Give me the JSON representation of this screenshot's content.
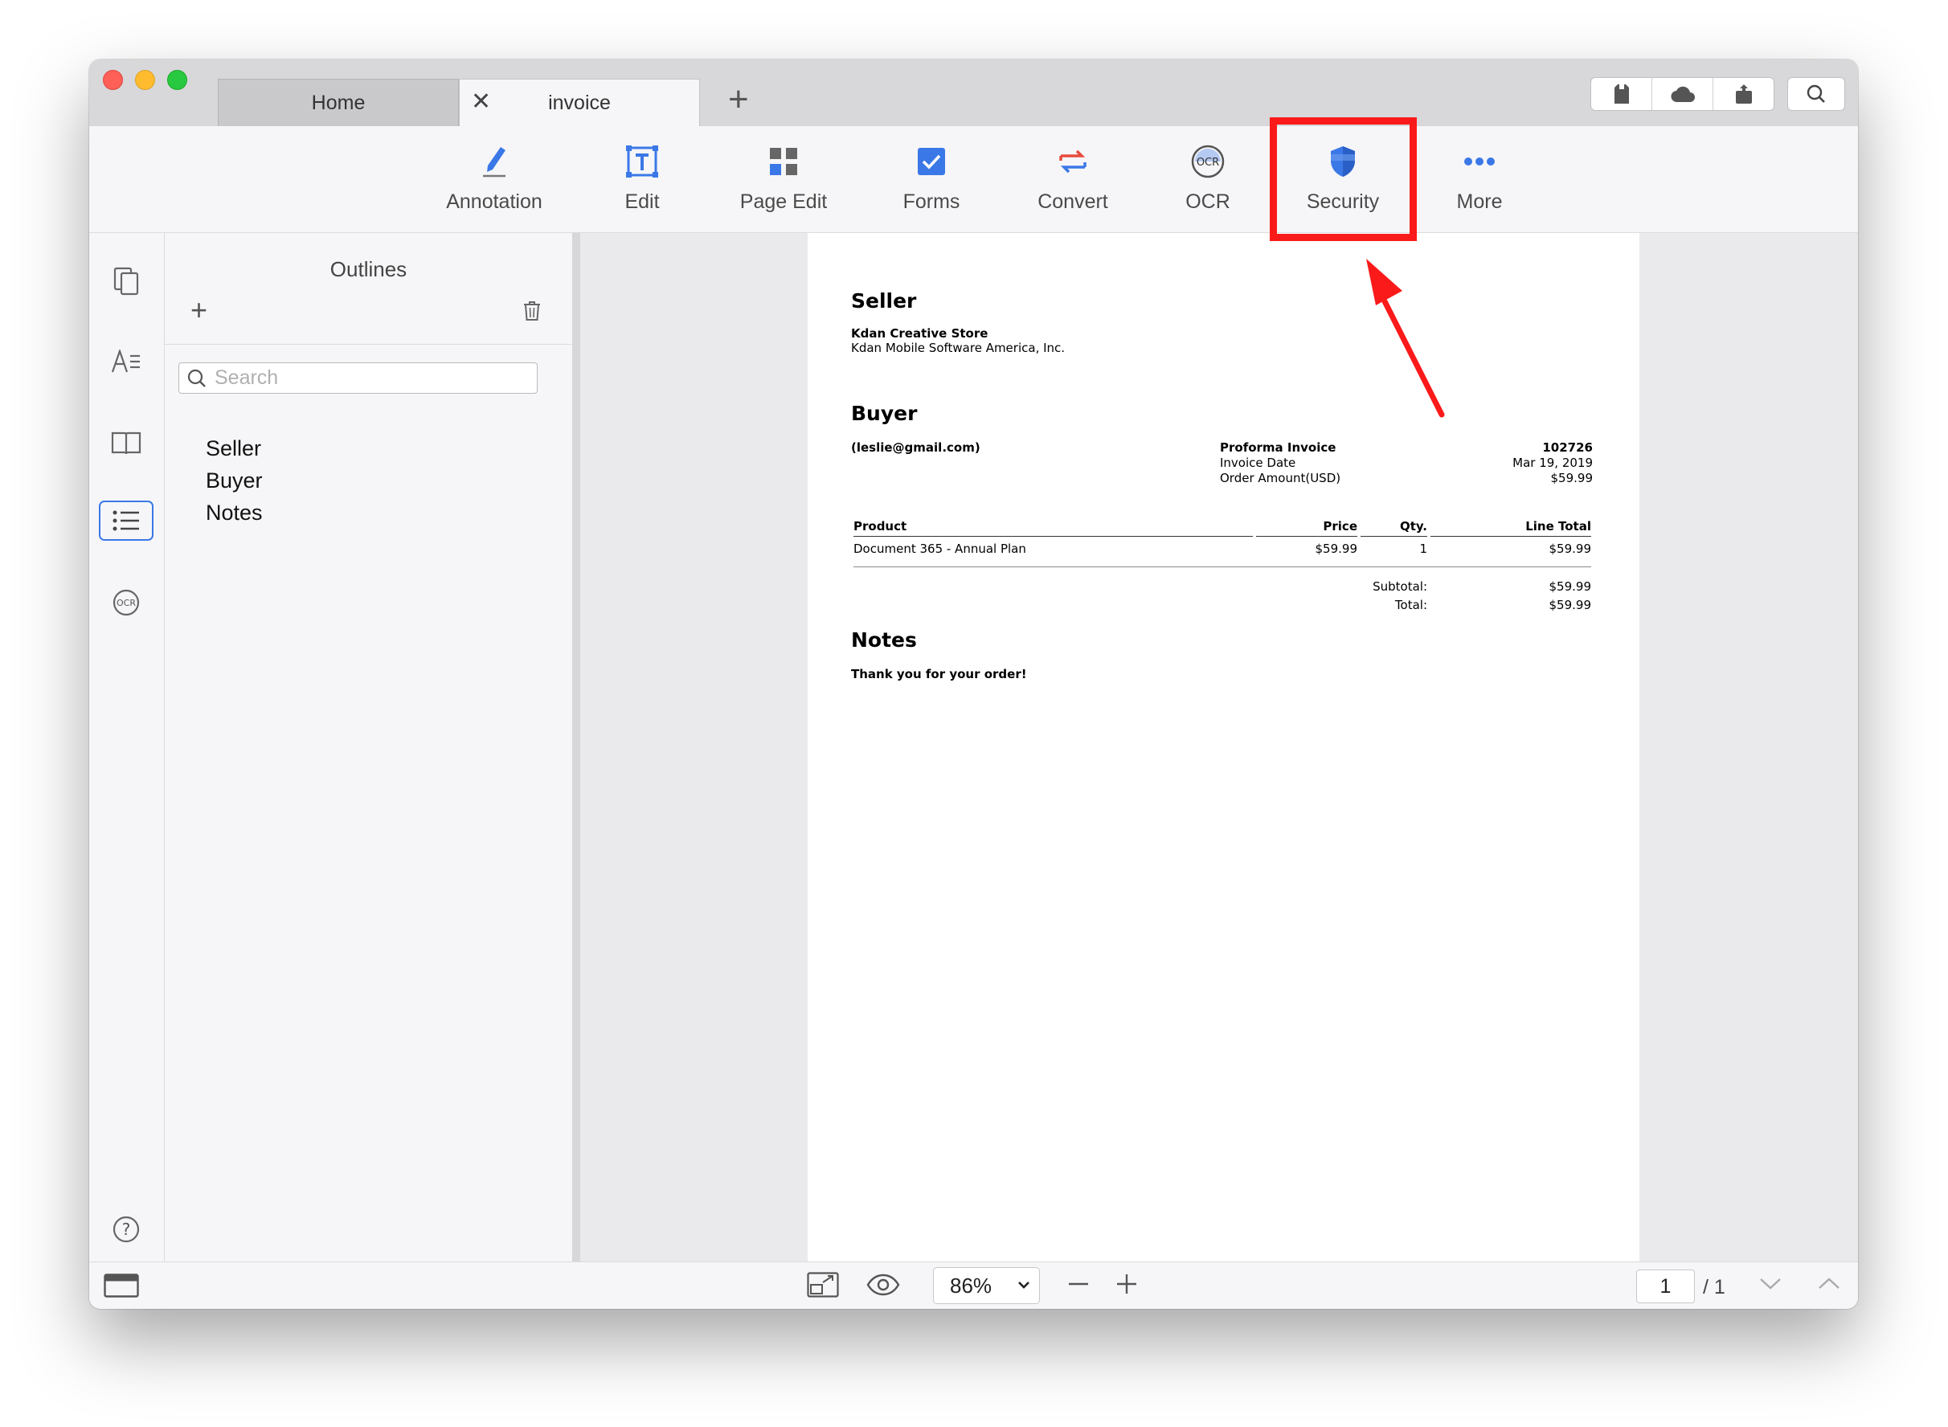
{
  "tabs": {
    "home": "Home",
    "active": "invoice"
  },
  "toolbar": {
    "items": [
      {
        "id": "annotation",
        "label": "Annotation",
        "icon": "pen-icon"
      },
      {
        "id": "edit",
        "label": "Edit",
        "icon": "text-edit-icon"
      },
      {
        "id": "page_edit",
        "label": "Page Edit",
        "icon": "grid-icon"
      },
      {
        "id": "forms",
        "label": "Forms",
        "icon": "checkbox-icon"
      },
      {
        "id": "convert",
        "label": "Convert",
        "icon": "convert-arrows-icon"
      },
      {
        "id": "ocr",
        "label": "OCR",
        "icon": "ocr-icon"
      },
      {
        "id": "security",
        "label": "Security",
        "icon": "shield-icon"
      },
      {
        "id": "more",
        "label": "More",
        "icon": "more-dots-icon"
      }
    ],
    "highlighted": "security",
    "highlight_color": "#fa1a1a"
  },
  "outlines": {
    "title": "Outlines",
    "search_placeholder": "Search",
    "items": [
      "Seller",
      "Buyer",
      "Notes"
    ]
  },
  "document": {
    "seller_heading": "Seller",
    "seller_name": "Kdan Creative Store",
    "seller_company": "Kdan Mobile Software America, Inc.",
    "buyer_heading": "Buyer",
    "buyer_email": "(leslie@gmail.com)",
    "invoice_title": "Proforma Invoice",
    "invoice_number": "102726",
    "invoice_date_label": "Invoice Date",
    "invoice_date": "Mar 19, 2019",
    "order_amount_label": "Order Amount(USD)",
    "order_amount": "$59.99",
    "table": {
      "headers": [
        "Product",
        "Price",
        "Qty.",
        "Line Total"
      ],
      "rows": [
        [
          "Document 365 - Annual Plan",
          "$59.99",
          "1",
          "$59.99"
        ]
      ]
    },
    "subtotal_label": "Subtotal:",
    "subtotal": "$59.99",
    "total_label": "Total:",
    "total": "$59.99",
    "notes_heading": "Notes",
    "notes_text": "Thank you for your order!"
  },
  "statusbar": {
    "zoom": "86%",
    "current_page": "1",
    "total_pages": "/ 1"
  },
  "colors": {
    "accent": "#3b78e7",
    "annotation_red": "#fa1a1a"
  }
}
